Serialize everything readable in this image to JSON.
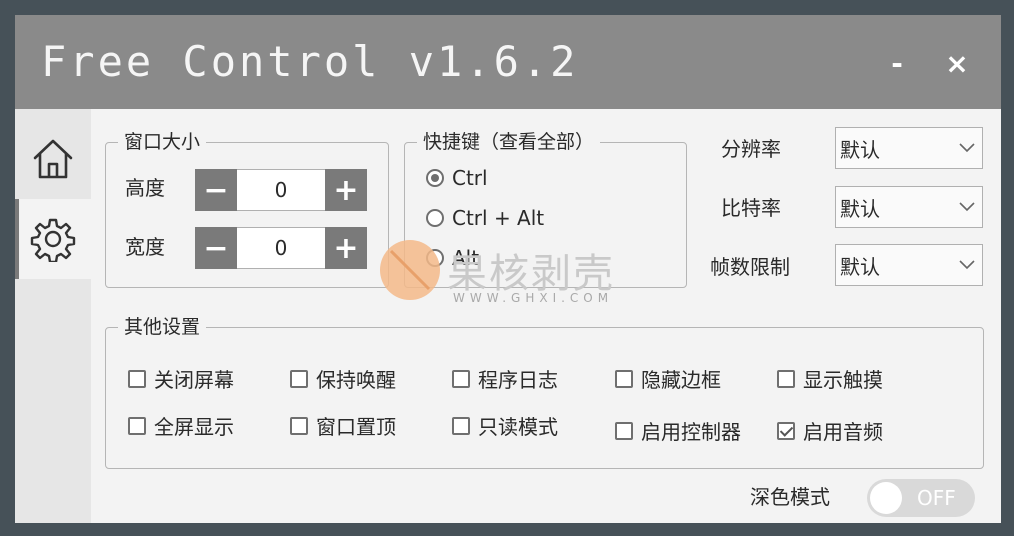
{
  "window": {
    "title": "Free Control v1.6.2",
    "minimize_label": "-",
    "close_label": "×"
  },
  "sidebar": {
    "items": [
      {
        "icon": "home-icon"
      },
      {
        "icon": "gear-icon",
        "active": true
      }
    ]
  },
  "window_size": {
    "title": "窗口大小",
    "height_label": "高度",
    "height_value": "0",
    "width_label": "宽度",
    "width_value": "0",
    "minus": "−",
    "plus": "+"
  },
  "hotkey": {
    "title": "快捷键（查看全部）",
    "options": [
      "Ctrl",
      "Ctrl + Alt",
      "Alt"
    ],
    "selected": "Ctrl"
  },
  "video": {
    "resolution_label": "分辨率",
    "resolution_value": "默认",
    "bitrate_label": "比特率",
    "bitrate_value": "默认",
    "fps_label": "帧数限制",
    "fps_value": "默认"
  },
  "other": {
    "title": "其他设置",
    "row1": [
      {
        "label": "关闭屏幕",
        "checked": false
      },
      {
        "label": "保持唤醒",
        "checked": false
      },
      {
        "label": "程序日志",
        "checked": false
      },
      {
        "label": "隐藏边框",
        "checked": false
      },
      {
        "label": "显示触摸",
        "checked": false
      }
    ],
    "row2": [
      {
        "label": "全屏显示",
        "checked": false
      },
      {
        "label": "窗口置顶",
        "checked": false
      },
      {
        "label": "只读模式",
        "checked": false
      },
      {
        "label": "启用控制器",
        "checked": false
      },
      {
        "label": "启用音频",
        "checked": true
      }
    ]
  },
  "dark_mode": {
    "label": "深色模式",
    "state": "OFF"
  },
  "watermark": {
    "text": "果核剥壳",
    "sub": "WWW.GHXI.COM"
  },
  "colors": {
    "titlebar": "#8a8a8a",
    "stepper": "#7a7a7a",
    "background": "#f3f3f3"
  }
}
